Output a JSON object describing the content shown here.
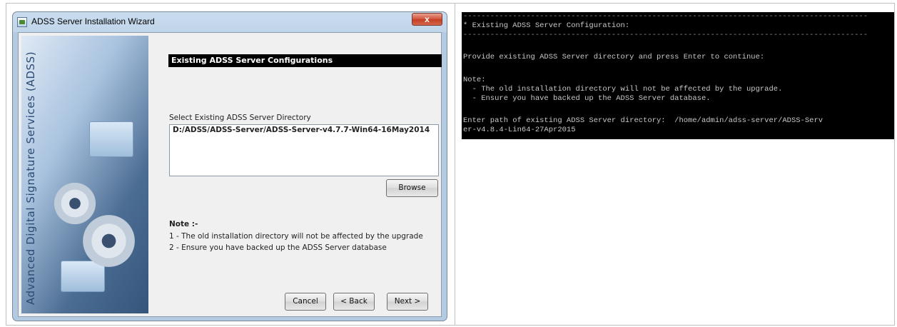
{
  "wizard": {
    "title": "ADSS Server Installation Wizard",
    "close_label": "x",
    "side_banner": "Advanced Digital Signature Services (ADSS)",
    "heading": "Existing ADSS Server Configurations",
    "select_label": "Select Existing ADSS Server Directory",
    "directory_value": "D:/ADSS/ADSS-Server/ADSS-Server-v4.7.7-Win64-16May2014",
    "browse_label": "Browse",
    "note_title": "Note :-",
    "notes": [
      "1 - The old installation directory will not be affected by the upgrade",
      "2 - Ensure you have backed up the ADSS Server database"
    ],
    "buttons": {
      "cancel": "Cancel",
      "back": "< Back",
      "next": "Next >"
    }
  },
  "console": {
    "lines": [
      "------------------------------------------------------------------------------------------",
      "* Existing ADSS Server Configuration:",
      "------------------------------------------------------------------------------------------",
      "",
      "Provide existing ADSS Server directory and press Enter to continue:",
      "",
      "Note:",
      "  - The old installation directory will not be affected by the upgrade.",
      "  - Ensure you have backed up the ADSS Server database.",
      "",
      "Enter path of existing ADSS Server directory:  /home/admin/adss-server/ADSS-Serv",
      "er-v4.8.4-Lin64-27Apr2015"
    ]
  }
}
